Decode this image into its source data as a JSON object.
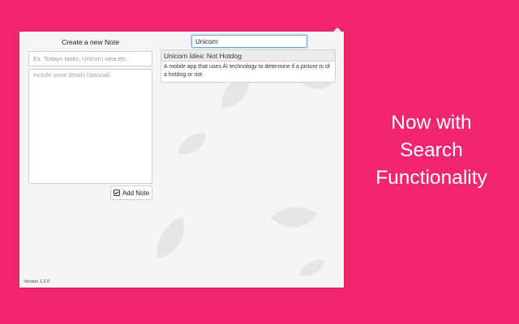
{
  "popup": {
    "create": {
      "title": "Create a new Note",
      "title_placeholder": "Ex. Todays tasks, Unicorn idea etc.",
      "details_placeholder": "Include some details (optional)",
      "add_button_label": "Add Note",
      "add_button_icon": "checkbox-icon"
    },
    "search": {
      "value": "Unicorn"
    },
    "results": [
      {
        "title": "Unicorn Idea: Not Hotdog",
        "body": "A mobile app that uses AI technology to determine if a picture is of a hotdog or not"
      }
    ],
    "version": "Version 1.2.0"
  },
  "promo": {
    "lines": [
      "Now with",
      "Search",
      "Functionality"
    ]
  },
  "colors": {
    "background": "#f1266f",
    "popup": "#f5f5f6",
    "leaf": "#e6e6e8",
    "search_focus": "#6fa8dc"
  }
}
